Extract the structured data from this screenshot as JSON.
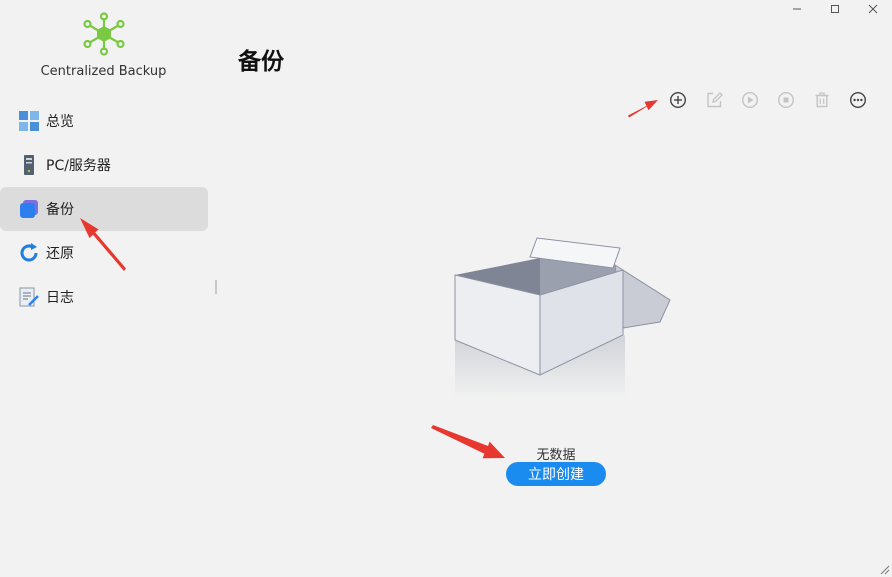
{
  "window": {
    "controls": [
      {
        "name": "minimize",
        "icon": "minimize-icon"
      },
      {
        "name": "maximize",
        "icon": "maximize-icon"
      },
      {
        "name": "close",
        "icon": "close-icon"
      }
    ]
  },
  "sidebar": {
    "app_name": "Centralized Backup",
    "logo_icon": "network-hub-icon",
    "logo_color": "#7ac943",
    "items": [
      {
        "label": "总览",
        "icon": "overview-grid-icon",
        "active": false
      },
      {
        "label": "PC/服务器",
        "icon": "server-tower-icon",
        "active": false
      },
      {
        "label": "备份",
        "icon": "backup-cube-icon",
        "active": true
      },
      {
        "label": "还原",
        "icon": "restore-circle-icon",
        "active": false
      },
      {
        "label": "日志",
        "icon": "log-document-icon",
        "active": false
      }
    ]
  },
  "main": {
    "title": "备份",
    "toolbar": [
      {
        "name": "create",
        "icon": "plus-circle-icon",
        "enabled": true
      },
      {
        "name": "edit",
        "icon": "edit-icon",
        "enabled": false
      },
      {
        "name": "run",
        "icon": "play-circle-icon",
        "enabled": false
      },
      {
        "name": "stop",
        "icon": "stop-circle-icon",
        "enabled": false
      },
      {
        "name": "delete",
        "icon": "trash-icon",
        "enabled": false
      },
      {
        "name": "more",
        "icon": "more-circle-icon",
        "enabled": true
      }
    ],
    "empty_state": {
      "illustration": "open-box-icon",
      "message": "无数据",
      "button_label": "立即创建"
    }
  },
  "colors": {
    "accent": "#1a8cf0",
    "annotation_arrow": "#e8372f",
    "active_nav_bg": "#dcdcdc",
    "background": "#f2f2f2"
  }
}
